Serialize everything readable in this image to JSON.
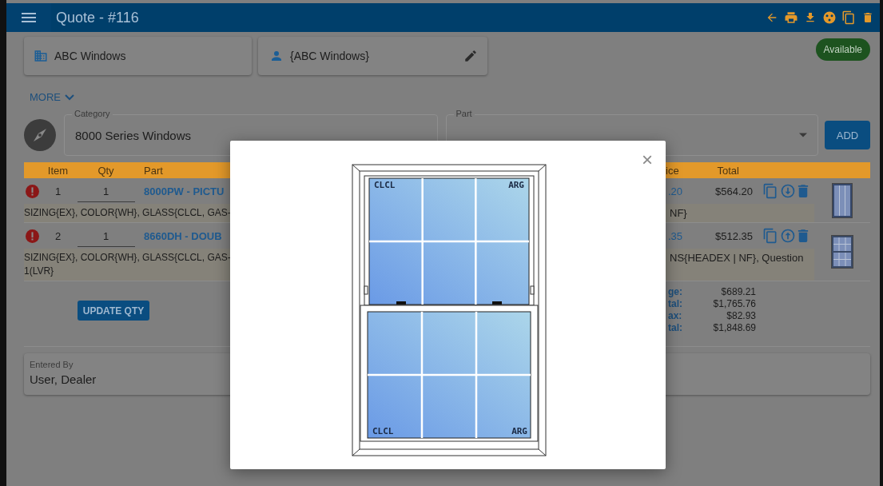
{
  "header": {
    "title": "Quote - #116"
  },
  "customer": {
    "company": "ABC Windows",
    "contact": "{ABC Windows}"
  },
  "status_badge": "Available",
  "more_link": "MORE",
  "category": {
    "label": "Category",
    "value": "8000 Series Windows"
  },
  "part": {
    "label": "Part"
  },
  "add_button": "ADD",
  "table": {
    "columns": [
      "Item",
      "Qty",
      "Part",
      "ice",
      "Total"
    ],
    "rows": [
      {
        "item": "1",
        "qty": "1",
        "part": "8000PW - PICTU",
        "price": ".20",
        "total": "$564.20",
        "arrow_up": false,
        "kind": "picture",
        "description_left": [
          "SIZING{EX}, COLOR{WH}, GLASS{CLCL, GAS-"
        ],
        "description_right": "NF}"
      },
      {
        "item": "2",
        "qty": "1",
        "part": "8660DH - DOUB",
        "price": ".35",
        "total": "$512.35",
        "arrow_up": true,
        "kind": "double-hung",
        "description_left": [
          "SIZING{EX}, COLOR{WH}, GLASS{CLCL, GAS-",
          "1(LVR}"
        ],
        "description_right": "NS{HEADEX | NF}, Question"
      }
    ]
  },
  "totals": [
    {
      "label": "ge:",
      "value": "$689.21"
    },
    {
      "label": "tal:",
      "value": "$1,765.76"
    },
    {
      "label": "ax:",
      "value": "$82.93"
    },
    {
      "label": "tal:",
      "value": "$1,848.69"
    }
  ],
  "update_button": "UPDATE QTY",
  "entered_by": {
    "label": "Entered By",
    "value": "User, Dealer"
  },
  "modal": {
    "close": "×",
    "glass_labels": {
      "top_left": "CLCL",
      "top_right": "ARG",
      "bottom_left": "CLCL",
      "bottom_right": "ARG"
    }
  }
}
